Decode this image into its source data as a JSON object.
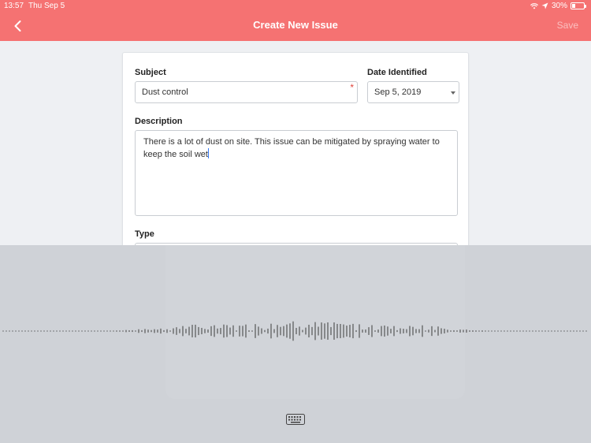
{
  "status_bar": {
    "time": "13:57",
    "date": "Thu Sep 5",
    "battery_percent": "30%",
    "battery_level": 0.3,
    "icons": [
      "wifi-icon",
      "location-icon",
      "battery-icon"
    ]
  },
  "nav": {
    "title": "Create New Issue",
    "save_label": "Save",
    "back_icon": "chevron-left-icon"
  },
  "form": {
    "subject_label": "Subject",
    "subject_value": "Dust control",
    "required_marker": "*",
    "date_label": "Date Identified",
    "date_value": "Sep 5, 2019",
    "description_label": "Description",
    "description_value": "There is a lot of dust on site. This issue can be mitigated by spraying water to keep the soil wet",
    "type_label": "Type"
  },
  "dictation": {
    "keyboard_icon": "keyboard-icon"
  },
  "colors": {
    "header": "#f57272",
    "required": "#e0433b",
    "cursor": "#3478f6",
    "dictation_bg": "#cfd2d7"
  }
}
